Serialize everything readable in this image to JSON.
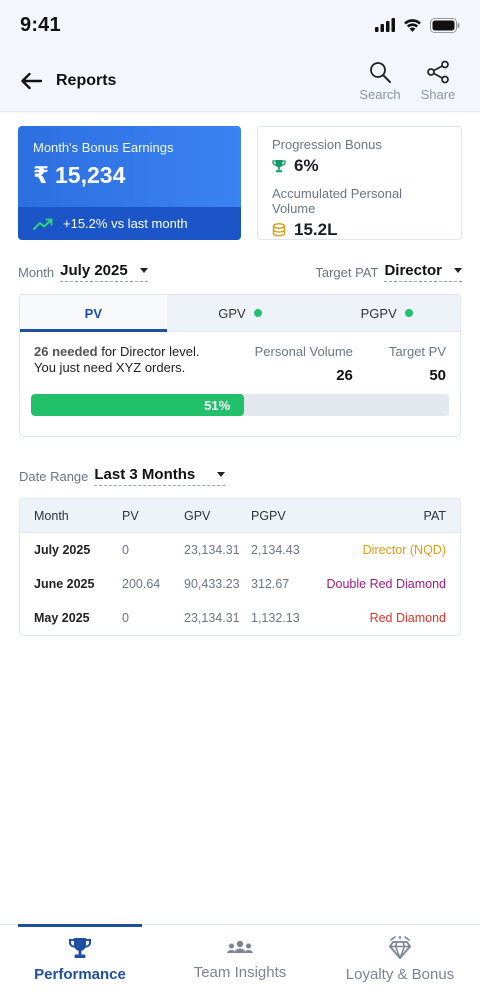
{
  "status_bar": {
    "time": "9:41"
  },
  "header": {
    "title": "Reports",
    "actions": [
      {
        "label": "Search",
        "icon": "search-icon"
      },
      {
        "label": "Share",
        "icon": "share-icon"
      }
    ]
  },
  "bonus_card": {
    "label": "Month's Bonus Earnings",
    "currency": "₹",
    "amount": "15,234",
    "trend": "+15.2% vs last month",
    "trend_icon": "trending-up-icon"
  },
  "stats_card": {
    "progression_label": "Progression Bonus",
    "progression_value": "6%",
    "volume_label": "Accumulated Personal Volume",
    "volume_value": "15.2L"
  },
  "filters": {
    "month_label": "Month",
    "month_value": "July 2025",
    "target_label": "Target PAT",
    "target_value": "Director"
  },
  "pv_panel": {
    "tabs": [
      {
        "label": "PV",
        "active": true,
        "dot": false
      },
      {
        "label": "GPV",
        "active": false,
        "dot": true
      },
      {
        "label": "PGPV",
        "active": false,
        "dot": true
      }
    ],
    "needed_bold": "26 needed",
    "needed_rest": " for Director level.",
    "message_line2": "You just need XYZ orders.",
    "personal_volume_label": "Personal Volume",
    "personal_volume_value": "26",
    "target_pv_label": "Target PV",
    "target_pv_value": "50",
    "progress_percent": 51,
    "progress_label": "51%"
  },
  "date_range": {
    "label": "Date Range",
    "value": "Last 3 Months"
  },
  "table": {
    "headers": [
      "Month",
      "PV",
      "GPV",
      "PGPV",
      "PAT"
    ],
    "rows": [
      {
        "month": "July 2025",
        "pv": "0",
        "gpv": "23,134.31",
        "pgpv": "2,134.43",
        "pat": "Director (NQD)",
        "pat_color": "#e39a14"
      },
      {
        "month": "June 2025",
        "pv": "200.64",
        "gpv": "90,433.23",
        "pgpv": "312.67",
        "pat": "Double Red Diamond",
        "pat_color": "#9c1b86"
      },
      {
        "month": "May 2025",
        "pv": "0",
        "gpv": "23,134.31",
        "pgpv": "1,132.13",
        "pat": "Red Diamond",
        "pat_color": "#e0332c"
      }
    ]
  },
  "bottom_nav": [
    {
      "label": "Performance",
      "icon": "trophy-icon",
      "active": true
    },
    {
      "label": "Team Insights",
      "icon": "team-icon",
      "active": false
    },
    {
      "label": "Loyalty & Bonus",
      "icon": "diamond-icon",
      "active": false
    }
  ],
  "colors": {
    "primary": "#1f4fa0",
    "card_blue": "#3b83f2",
    "success": "#22c06f",
    "gold": "#d4a017",
    "teal": "#139a6a"
  }
}
